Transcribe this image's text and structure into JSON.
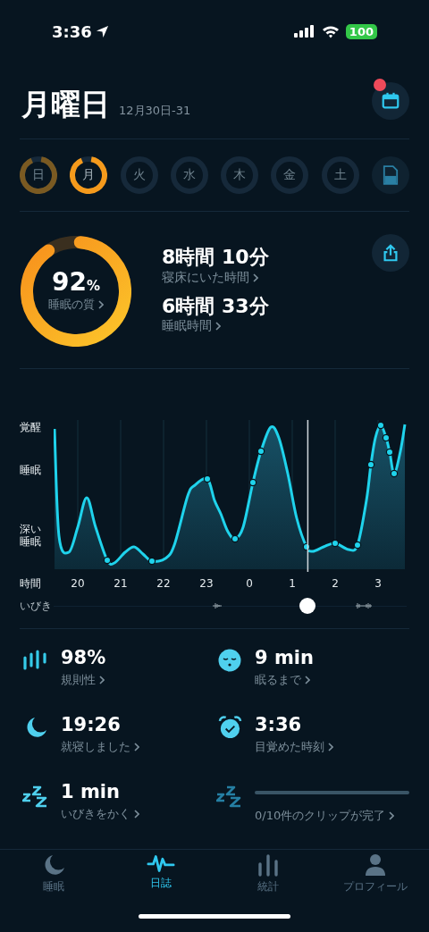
{
  "status_bar": {
    "time": "3:36",
    "battery": "100"
  },
  "header": {
    "title": "月曜日",
    "date_range": "12月30日-31",
    "notification": true
  },
  "days": [
    {
      "label": "日",
      "recorded": true,
      "selected": false
    },
    {
      "label": "月",
      "recorded": true,
      "selected": true
    },
    {
      "label": "火",
      "recorded": false,
      "selected": false
    },
    {
      "label": "水",
      "recorded": false,
      "selected": false
    },
    {
      "label": "木",
      "recorded": false,
      "selected": false
    },
    {
      "label": "金",
      "recorded": false,
      "selected": false
    },
    {
      "label": "土",
      "recorded": false,
      "selected": false
    }
  ],
  "summary": {
    "quality": {
      "value": "92",
      "unit": "%",
      "label": "睡眠の質"
    },
    "metrics": [
      {
        "value": "8時間 10分",
        "label": "寝床にいた時間"
      },
      {
        "value": "6時間 33分",
        "label": "睡眠時間"
      }
    ]
  },
  "chart": {
    "y_labels": [
      "覚醒",
      "睡眠",
      "深い睡眠"
    ],
    "x_title": "時間",
    "x_labels": [
      "20",
      "21",
      "22",
      "23",
      "0",
      "1",
      "2",
      "3"
    ],
    "snore": {
      "label": "いびき",
      "level": 0.72
    }
  },
  "stats": [
    {
      "kind": "regularity",
      "value": "98%",
      "label": "規則性"
    },
    {
      "kind": "latency",
      "value": "9 min",
      "label": "眠るまで"
    },
    {
      "kind": "bedtime",
      "value": "19:26",
      "label": "就寝しました"
    },
    {
      "kind": "wake",
      "value": "3:36",
      "label": "目覚めた時刻"
    },
    {
      "kind": "snore",
      "value": "1 min",
      "label": "いびきをかく"
    },
    {
      "kind": "clips",
      "label": "0/10件のクリップが完了"
    }
  ],
  "tabs": [
    {
      "kind": "sleep",
      "label": "睡眠",
      "selected": false
    },
    {
      "kind": "journal",
      "label": "日誌",
      "selected": true
    },
    {
      "kind": "stats",
      "label": "統計",
      "selected": false
    },
    {
      "kind": "profile",
      "label": "プロフィール",
      "selected": false
    }
  ]
}
